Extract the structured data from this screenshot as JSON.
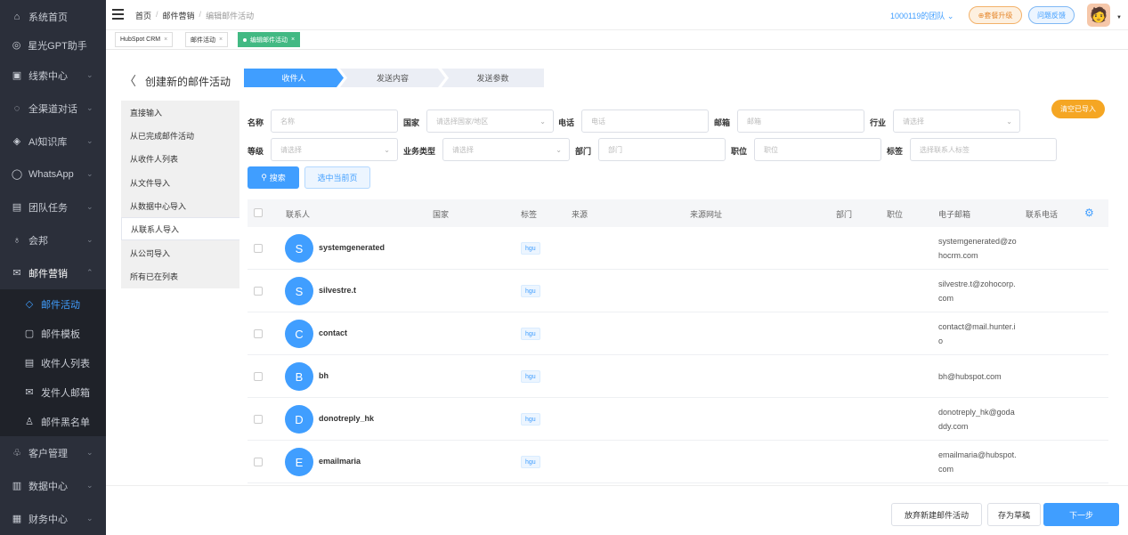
{
  "sidebar": {
    "items": [
      {
        "label": "系统首页",
        "icon": "home-icon",
        "glyph": "⌂",
        "arrow": ""
      },
      {
        "label": "星光GPT助手",
        "icon": "gpt-icon",
        "glyph": "◎",
        "arrow": ""
      },
      {
        "label": "线索中心",
        "icon": "lead-icon",
        "glyph": "▣",
        "arrow": "⌄"
      },
      {
        "label": "全渠道对话",
        "icon": "chat-icon",
        "glyph": "◌",
        "arrow": "⌄"
      },
      {
        "label": "AI知识库",
        "icon": "knowledge-icon",
        "glyph": "◈",
        "arrow": "⌄"
      },
      {
        "label": "WhatsApp",
        "icon": "whatsapp-icon",
        "glyph": "◯",
        "arrow": "⌄"
      },
      {
        "label": "团队任务",
        "icon": "task-icon",
        "glyph": "▤",
        "arrow": "⌄"
      },
      {
        "label": "会邦",
        "icon": "bulb-icon",
        "glyph": "♁",
        "arrow": "⌄"
      },
      {
        "label": "邮件营销",
        "icon": "mail-icon",
        "glyph": "✉",
        "arrow": "⌃"
      }
    ],
    "subitems": [
      {
        "label": "邮件活动",
        "icon": "campaign-icon",
        "glyph": "◇"
      },
      {
        "label": "邮件模板",
        "icon": "template-icon",
        "glyph": "▢"
      },
      {
        "label": "收件人列表",
        "icon": "list-icon",
        "glyph": "▤"
      },
      {
        "label": "发件人邮箱",
        "icon": "sender-icon",
        "glyph": "✉"
      },
      {
        "label": "邮件黑名单",
        "icon": "blacklist-icon",
        "glyph": "♙"
      }
    ],
    "bottom": [
      {
        "label": "客户管理",
        "icon": "customer-icon",
        "glyph": "♧",
        "arrow": "⌄"
      },
      {
        "label": "数据中心",
        "icon": "data-icon",
        "glyph": "▥",
        "arrow": "⌄"
      },
      {
        "label": "财务中心",
        "icon": "finance-icon",
        "glyph": "▦",
        "arrow": "⌄"
      }
    ]
  },
  "topbar": {
    "breadcrumb": {
      "home": "首页",
      "sep": "/",
      "section": "邮件营销",
      "current": "编辑邮件活动"
    },
    "team": "1000119的团队 ⌄",
    "upgrade": "⊕套餐升级",
    "feedback": "问题反馈",
    "avatar": "🧑",
    "caret": "▼"
  },
  "tabs": [
    {
      "label": "HubSpot CRM",
      "close": "×"
    },
    {
      "label": "邮件活动",
      "close": "×"
    },
    {
      "label": "编辑邮件活动",
      "close": "×"
    }
  ],
  "page": {
    "back_icon": "〈",
    "title": "创建新的邮件活动",
    "steps": [
      "收件人",
      "发送内容",
      "发送参数"
    ]
  },
  "sources": [
    "直接输入",
    "从已完成邮件活动",
    "从收件人列表",
    "从文件导入",
    "从数据中心导入",
    "从联系人导入",
    "从公司导入",
    "所有已在列表"
  ],
  "filters": {
    "name_label": "名称",
    "name_ph": "名称",
    "country_label": "国家",
    "country_ph": "请选择国家/地区",
    "phone_label": "电话",
    "phone_ph": "电话",
    "email_label": "邮箱",
    "email_ph": "邮箱",
    "industry_label": "行业",
    "industry_ph": "请选择",
    "level_label": "等级",
    "level_ph": "请选择",
    "biz_label": "业务类型",
    "biz_ph": "请选择",
    "dept_label": "部门",
    "dept_ph": "部门",
    "position_label": "职位",
    "position_ph": "职位",
    "tag_label": "标签",
    "tag_ph": "选择联系人标签",
    "dropdown": "⌄"
  },
  "actions": {
    "clear": "清空已导入",
    "search": "搜索",
    "search_icon": "⚲",
    "select_page": "选中当前页"
  },
  "table": {
    "headers": [
      "联系人",
      "国家",
      "标签",
      "来源",
      "来源网址",
      "部门",
      "职位",
      "电子邮箱",
      "联系电话"
    ],
    "settings_icon": "⚙",
    "rows": [
      {
        "initial": "S",
        "name": "systemgenerated",
        "tag": "hgu",
        "email": "systemgenerated@zohocrm.com"
      },
      {
        "initial": "S",
        "name": "silvestre.t",
        "tag": "hgu",
        "email": "silvestre.t@zohocorp.com"
      },
      {
        "initial": "C",
        "name": "contact",
        "tag": "hgu",
        "email": "contact@mail.hunter.io"
      },
      {
        "initial": "B",
        "name": "bh",
        "tag": "hgu",
        "email": "bh@hubspot.com"
      },
      {
        "initial": "D",
        "name": "donotreply_hk",
        "tag": "hgu",
        "email": "donotreply_hk@godaddy.com"
      },
      {
        "initial": "E",
        "name": "emailmaria",
        "tag": "hgu",
        "email": "emailmaria@hubspot.com"
      }
    ]
  },
  "footer": {
    "discard": "放弃新建邮件活动",
    "draft": "存为草稿",
    "next": "下一步"
  }
}
